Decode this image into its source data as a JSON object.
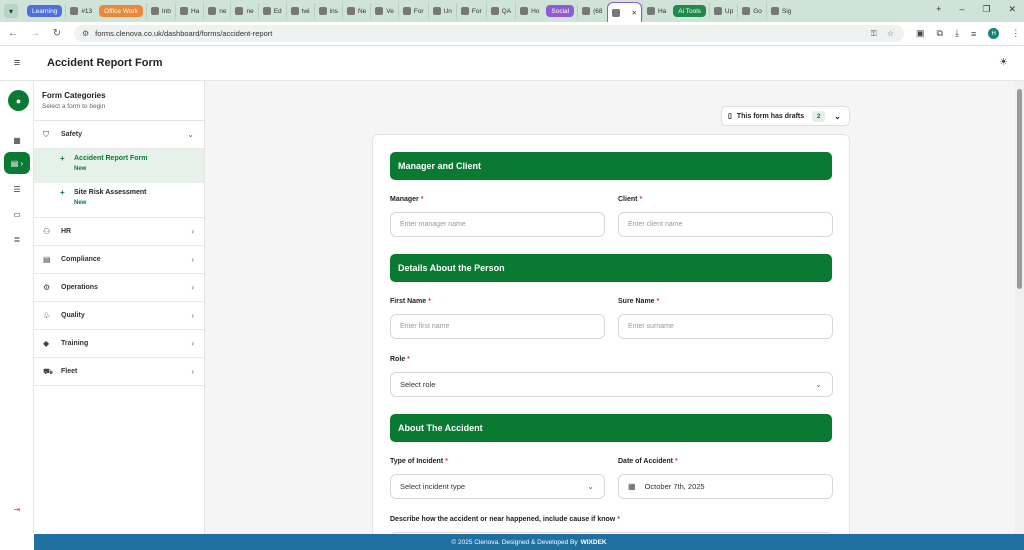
{
  "browser": {
    "tabs": [
      {
        "type": "group",
        "label": "Learning",
        "color": "#4f6fe0"
      },
      {
        "type": "tab",
        "label": "#13",
        "icon": "youtube-icon"
      },
      {
        "type": "group",
        "label": "Office Work",
        "color": "#e88a3a"
      },
      {
        "type": "tab",
        "label": "Inb",
        "icon": "mail-icon"
      },
      {
        "type": "tab",
        "label": "Ha",
        "icon": "github-icon"
      },
      {
        "type": "tab",
        "label": "ne",
        "icon": "x-icon"
      },
      {
        "type": "tab",
        "label": "ne",
        "icon": "x-icon"
      },
      {
        "type": "tab",
        "label": "Ed",
        "icon": "doc-icon"
      },
      {
        "type": "tab",
        "label": "twi",
        "icon": "github-icon"
      },
      {
        "type": "tab",
        "label": "ins",
        "icon": "app-icon"
      },
      {
        "type": "tab",
        "label": "Ne",
        "icon": "globe-icon"
      },
      {
        "type": "tab",
        "label": "Ve",
        "icon": "vercel-icon"
      },
      {
        "type": "tab",
        "label": "For",
        "icon": "doc-icon"
      },
      {
        "type": "tab",
        "label": "Un",
        "icon": "doc-icon"
      },
      {
        "type": "tab",
        "label": "For",
        "icon": "doc-icon"
      },
      {
        "type": "tab",
        "label": "QA",
        "icon": "doc-icon"
      },
      {
        "type": "tab",
        "label": "Ho",
        "icon": "drive-icon"
      },
      {
        "type": "group",
        "label": "Social",
        "color": "#8e5bd3"
      },
      {
        "type": "tab",
        "label": "(68",
        "icon": "spotify-icon"
      },
      {
        "type": "tab",
        "label": "",
        "icon": "slack-icon",
        "active": true
      },
      {
        "type": "tab",
        "label": "Ha",
        "icon": "github-icon"
      },
      {
        "type": "group",
        "label": "Ai Tools",
        "color": "#1f8a4c"
      },
      {
        "type": "tab",
        "label": "Up",
        "icon": "globe-icon"
      },
      {
        "type": "tab",
        "label": "Go",
        "icon": "gemini-icon"
      },
      {
        "type": "tab",
        "label": "Sig",
        "icon": "app-icon"
      }
    ],
    "url": "forms.clenova.co.uk/dashboard/forms/accident-report",
    "profile_initial": "H"
  },
  "header": {
    "title": "Accident Report Form"
  },
  "sidebar": {
    "title": "Form Categories",
    "subtitle": "Select a form to begin",
    "categories": [
      {
        "label": "Safety",
        "icon": "shield-icon",
        "expanded": true
      },
      {
        "label": "HR",
        "icon": "users-icon"
      },
      {
        "label": "Compliance",
        "icon": "document-icon"
      },
      {
        "label": "Operations",
        "icon": "gear-icon"
      },
      {
        "label": "Quality",
        "icon": "award-icon"
      },
      {
        "label": "Training",
        "icon": "graduation-cap-icon"
      },
      {
        "label": "Fleet",
        "icon": "truck-icon"
      }
    ],
    "safety_forms": [
      {
        "name": "Accident Report Form",
        "badge": "New",
        "active": true
      },
      {
        "name": "Site Risk Assessment",
        "badge": "New"
      }
    ]
  },
  "drafts": {
    "label": "This form has drafts",
    "count": "2"
  },
  "form": {
    "sections": {
      "manager_client": "Manager and Client",
      "person": "Details About the Person",
      "accident": "About The Accident"
    },
    "fields": {
      "manager": {
        "label": "Manager",
        "placeholder": "Enter manager name"
      },
      "client": {
        "label": "Client",
        "placeholder": "Enter client name"
      },
      "first_name": {
        "label": "First Name",
        "placeholder": "Enter first name"
      },
      "surname": {
        "label": "Sure Name",
        "placeholder": "Enter surname"
      },
      "role": {
        "label": "Role",
        "value": "Select role"
      },
      "incident_type": {
        "label": "Type of Incident",
        "value": "Select incident type"
      },
      "date": {
        "label": "Date of Accident",
        "value": "October 7th, 2025"
      },
      "description": {
        "label": "Describe how the accident or near happened, include cause if know"
      }
    },
    "required_mark": "*"
  },
  "footer": {
    "text": "© 2025 Clenova. Designed & Developed By",
    "brand": "WIXDEK"
  },
  "colors": {
    "primary": "#0a7a33",
    "footer": "#1f6fa0"
  }
}
